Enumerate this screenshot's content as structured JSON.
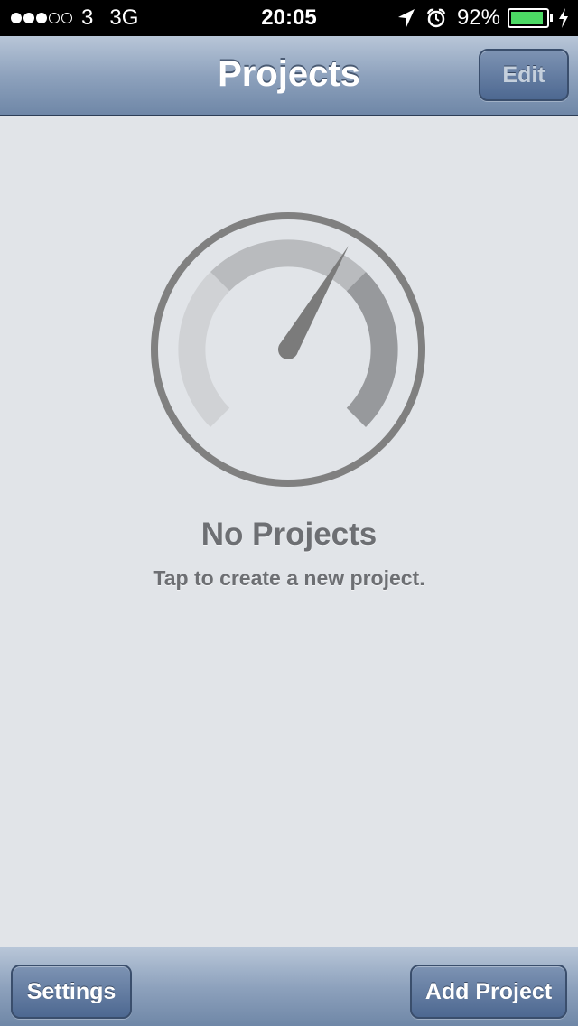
{
  "status_bar": {
    "carrier": "3",
    "network": "3G",
    "time": "20:05",
    "battery_percent": "92%",
    "battery_level": 0.92,
    "battery_color": "#4cd964",
    "signal_bars_filled": 3,
    "signal_bars_total": 5,
    "icons": [
      "location-arrow-icon",
      "alarm-clock-icon",
      "battery-icon",
      "charging-bolt-icon"
    ]
  },
  "nav": {
    "title": "Projects",
    "edit_label": "Edit"
  },
  "empty_state": {
    "icon": "speedometer-icon",
    "title": "No Projects",
    "subtitle": "Tap to create a new project."
  },
  "toolbar": {
    "settings_label": "Settings",
    "add_project_label": "Add Project"
  },
  "colors": {
    "background": "#e1e4e8",
    "nav_gradient_top": "#b8c6d8",
    "nav_gradient_bottom": "#6f87a7",
    "button_blue": "#4d6891",
    "empty_text": "#6d6f73"
  }
}
